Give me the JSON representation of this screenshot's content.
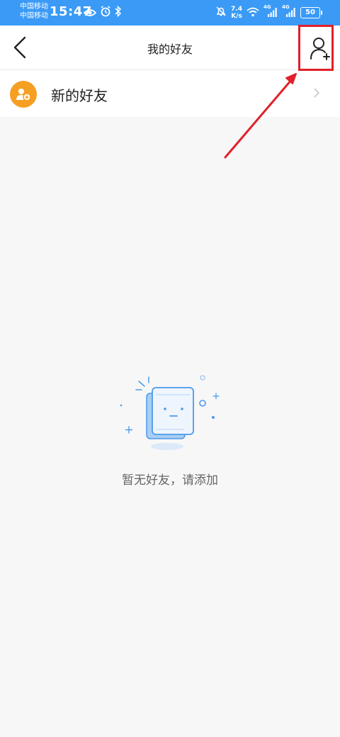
{
  "status_bar": {
    "carrier_1": "中国移动",
    "carrier_2": "中国移动",
    "time": "15:47",
    "net_speed_value": "7.4",
    "net_speed_unit": "K/s",
    "signal_1_label": "4G",
    "signal_2_label": "4G",
    "battery_level": "50"
  },
  "nav": {
    "title": "我的好友"
  },
  "list": {
    "new_friends_label": "新的好友"
  },
  "empty_state": {
    "message": "暂无好友，请添加"
  },
  "colors": {
    "status_bar": "#3a9af6",
    "accent_orange": "#f5a023",
    "annotation_red": "#e0202a",
    "illustration_blue": "#4a9bea"
  }
}
